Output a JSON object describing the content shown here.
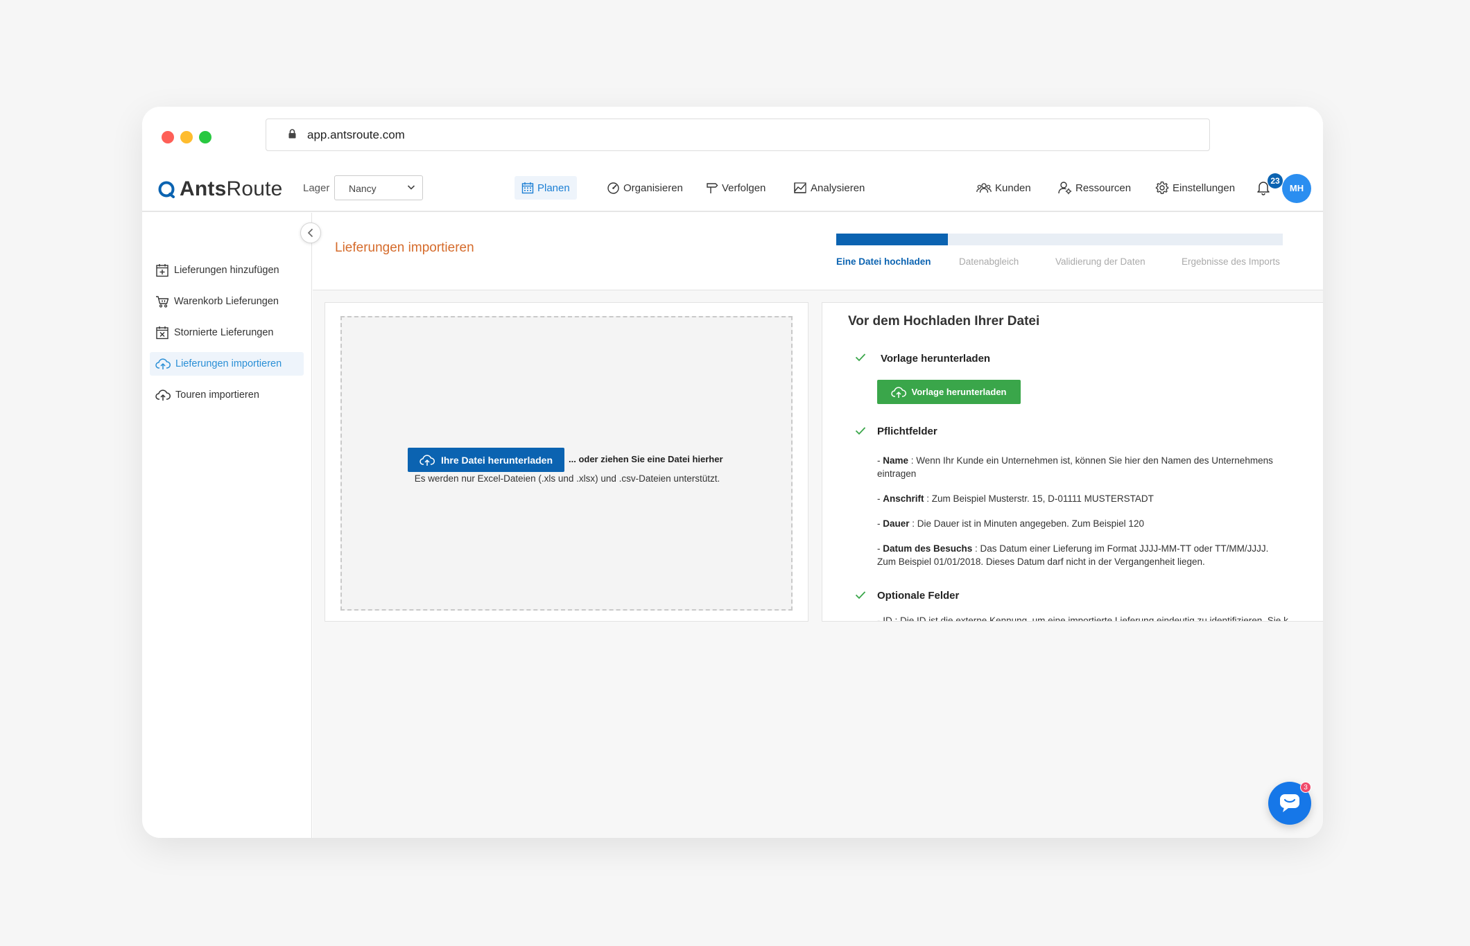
{
  "browser": {
    "url": "app.antsroute.com"
  },
  "app": {
    "logo_bold": "Ants",
    "logo_light": "Route"
  },
  "warehouse": {
    "label": "Lager",
    "value": "Nancy"
  },
  "nav": {
    "planen": "Planen",
    "organisieren": "Organisieren",
    "verfolgen": "Verfolgen",
    "analysieren": "Analysieren",
    "kunden": "Kunden",
    "ressourcen": "Ressourcen",
    "einstellungen": "Einstellungen"
  },
  "notifications": {
    "count": "23"
  },
  "user": {
    "initials": "MH"
  },
  "sidebar": {
    "items": [
      {
        "label": "Lieferungen hinzufügen",
        "icon": "calendar-plus-icon"
      },
      {
        "label": "Warenkorb Lieferungen",
        "icon": "cart-icon"
      },
      {
        "label": "Stornierte Lieferungen",
        "icon": "calendar-x-icon"
      },
      {
        "label": "Lieferungen importieren",
        "icon": "cloud-upload-icon",
        "active": true
      },
      {
        "label": "Touren importieren",
        "icon": "cloud-upload-icon"
      }
    ]
  },
  "page": {
    "title": "Lieferungen importieren"
  },
  "steps": {
    "progress": 0.25,
    "items": [
      "Eine Datei hochladen",
      "Datenabgleich",
      "Validierung der Daten",
      "Ergebnisse des Imports"
    ],
    "active_index": 0
  },
  "upload": {
    "button_label": "Ihre Datei herunterladen",
    "drag_text": "... oder ziehen Sie eine Datei hierher",
    "hint": "Es werden nur Excel-Dateien (.xls und .xlsx) und .csv-Dateien unterstützt."
  },
  "info": {
    "title": "Vor dem Hochladen Ihrer Datei",
    "template_section": "Vorlage herunterladen",
    "template_button": "Vorlage herunterladen",
    "required_section": "Pflichtfelder",
    "required": [
      {
        "name": "Name",
        "text": " : Wenn Ihr Kunde ein Unternehmen ist, können Sie hier den Namen des Unternehmens eintragen"
      },
      {
        "name": "Anschrift",
        "text": " : Zum Beispiel Musterstr. 15, D-01111 MUSTERSTADT"
      },
      {
        "name": "Dauer",
        "text": " : Die Dauer ist in Minuten angegeben. Zum Beispiel 120"
      },
      {
        "name": "Datum des Besuchs",
        "text": " : Das Datum einer Lieferung im Format JJJJ-MM-TT oder TT/MM/JJJJ. Zum Beispiel 01/01/2018. Dieses Datum darf nicht in der Vergangenheit liegen."
      }
    ],
    "optional_section": "Optionale Felder",
    "optional_cut": "- ID : Die ID ist die externe Kennung, um eine importierte Lieferung eindeutig zu identifizieren. Sie k"
  },
  "chat": {
    "badge": "3"
  },
  "colors": {
    "primary": "#0b63b1",
    "accent_orange": "#d56b2b",
    "success": "#3aa64a",
    "chat": "#1677e8"
  }
}
